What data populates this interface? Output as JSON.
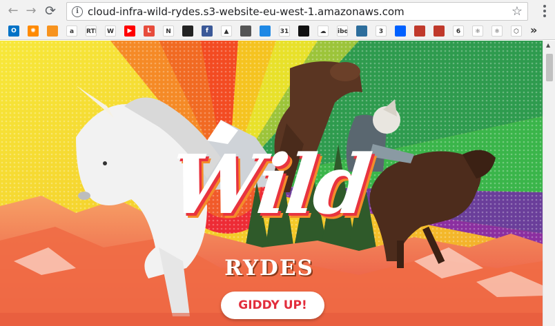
{
  "browser": {
    "url": "cloud-infra-wild-rydes.s3-website-eu-west-1.amazonaws.com",
    "nav_icons": [
      "back-arrow-icon",
      "forward-arrow-icon",
      "reload-icon",
      "info-icon",
      "star-icon",
      "menu-icon"
    ],
    "back_glyph": "←",
    "forward_glyph": "→",
    "reload_glyph": "⟳",
    "info_glyph": "i",
    "star_glyph": "☆",
    "overflow_glyph": "»"
  },
  "bookmarks": [
    {
      "name": "outlook",
      "label": "O",
      "color": "#0072c6"
    },
    {
      "name": "sun",
      "label": "✺",
      "color": "#ff8a00"
    },
    {
      "name": "box",
      "label": "",
      "color": "#f7931e"
    },
    {
      "name": "amazon",
      "label": "a",
      "color": "#ffffff"
    },
    {
      "name": "rte",
      "label": "RTÉ",
      "color": "#ffffff"
    },
    {
      "name": "wikipedia",
      "label": "W",
      "color": "#ffffff"
    },
    {
      "name": "youtube",
      "label": "▶",
      "color": "#ff0000"
    },
    {
      "name": "l",
      "label": "L",
      "color": "#e74c3c"
    },
    {
      "name": "netflix",
      "label": "N",
      "color": "#ffffff"
    },
    {
      "name": "nhl",
      "label": "",
      "color": "#222222"
    },
    {
      "name": "facebook",
      "label": "f",
      "color": "#3b5998"
    },
    {
      "name": "bookmark-12",
      "label": "▲",
      "color": "#ffffff"
    },
    {
      "name": "bookmark-13",
      "label": "",
      "color": "#555555"
    },
    {
      "name": "pocket",
      "label": "",
      "color": "#1e88e5"
    },
    {
      "name": "calendar",
      "label": "31",
      "color": "#ffffff"
    },
    {
      "name": "github",
      "label": "",
      "color": "#111111"
    },
    {
      "name": "cloud",
      "label": "☁",
      "color": "#ffffff"
    },
    {
      "name": "iboss",
      "label": "iboss",
      "color": "#ffffff"
    },
    {
      "name": "layers",
      "label": "",
      "color": "#2d6e9c"
    },
    {
      "name": "three",
      "label": "3",
      "color": "#ffffff"
    },
    {
      "name": "dropbox",
      "label": "",
      "color": "#0061ff"
    },
    {
      "name": "bookmark-22",
      "label": "",
      "color": "#c0392b"
    },
    {
      "name": "bookmark-23",
      "label": "",
      "color": "#c0392b"
    },
    {
      "name": "six",
      "label": "6",
      "color": "#ffffff"
    },
    {
      "name": "react-1",
      "label": "⚛",
      "color": "#ffffff"
    },
    {
      "name": "react-2",
      "label": "⚛",
      "color": "#ffffff"
    },
    {
      "name": "cube",
      "label": "⬡",
      "color": "#ffffff"
    }
  ],
  "hero": {
    "title_script": "Wild",
    "title_caps": "RYDES",
    "cta_label": "GIDDY UP!",
    "colors": {
      "accent_red": "#e22d3c",
      "yellow": "#f5e02a",
      "orange": "#f48c2a",
      "green": "#3ab54a",
      "purple": "#6a3e9a",
      "mountain": "#f06b45"
    }
  }
}
